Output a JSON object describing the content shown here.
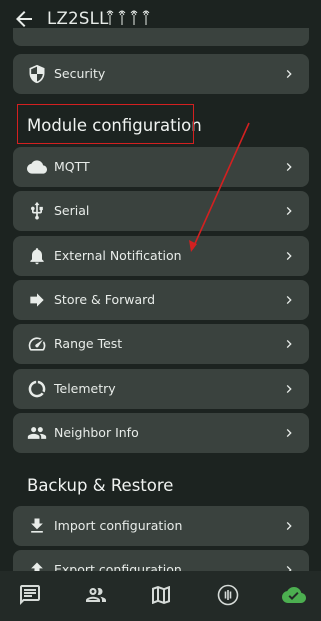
{
  "appbar": {
    "title": "LZ2SLL",
    "back_icon": "arrow-left-icon",
    "antenna_icons": "antenna-icons"
  },
  "radio_items": [
    {
      "label": "Security",
      "icon": "shield-icon"
    }
  ],
  "module_section": {
    "title": "Module configuration",
    "items": [
      {
        "label": "MQTT",
        "icon": "cloud-icon"
      },
      {
        "label": "Serial",
        "icon": "usb-icon"
      },
      {
        "label": "External Notification",
        "icon": "bell-icon"
      },
      {
        "label": "Store & Forward",
        "icon": "forward-arrow-icon"
      },
      {
        "label": "Range Test",
        "icon": "speed-icon"
      },
      {
        "label": "Telemetry",
        "icon": "data-usage-icon"
      },
      {
        "label": "Neighbor Info",
        "icon": "people-icon"
      }
    ]
  },
  "backup_section": {
    "title": "Backup & Restore",
    "items": [
      {
        "label": "Import configuration",
        "icon": "download-icon"
      },
      {
        "label": "Export configuration",
        "icon": "upload-icon"
      }
    ]
  },
  "bottom_nav": [
    "messages-icon",
    "contacts-icon",
    "map-icon",
    "channels-icon",
    "connected-cloud-icon"
  ],
  "colors": {
    "background": "#1c2320",
    "card": "#3a423e",
    "annotation": "#d32020",
    "connected": "#4caf50"
  }
}
